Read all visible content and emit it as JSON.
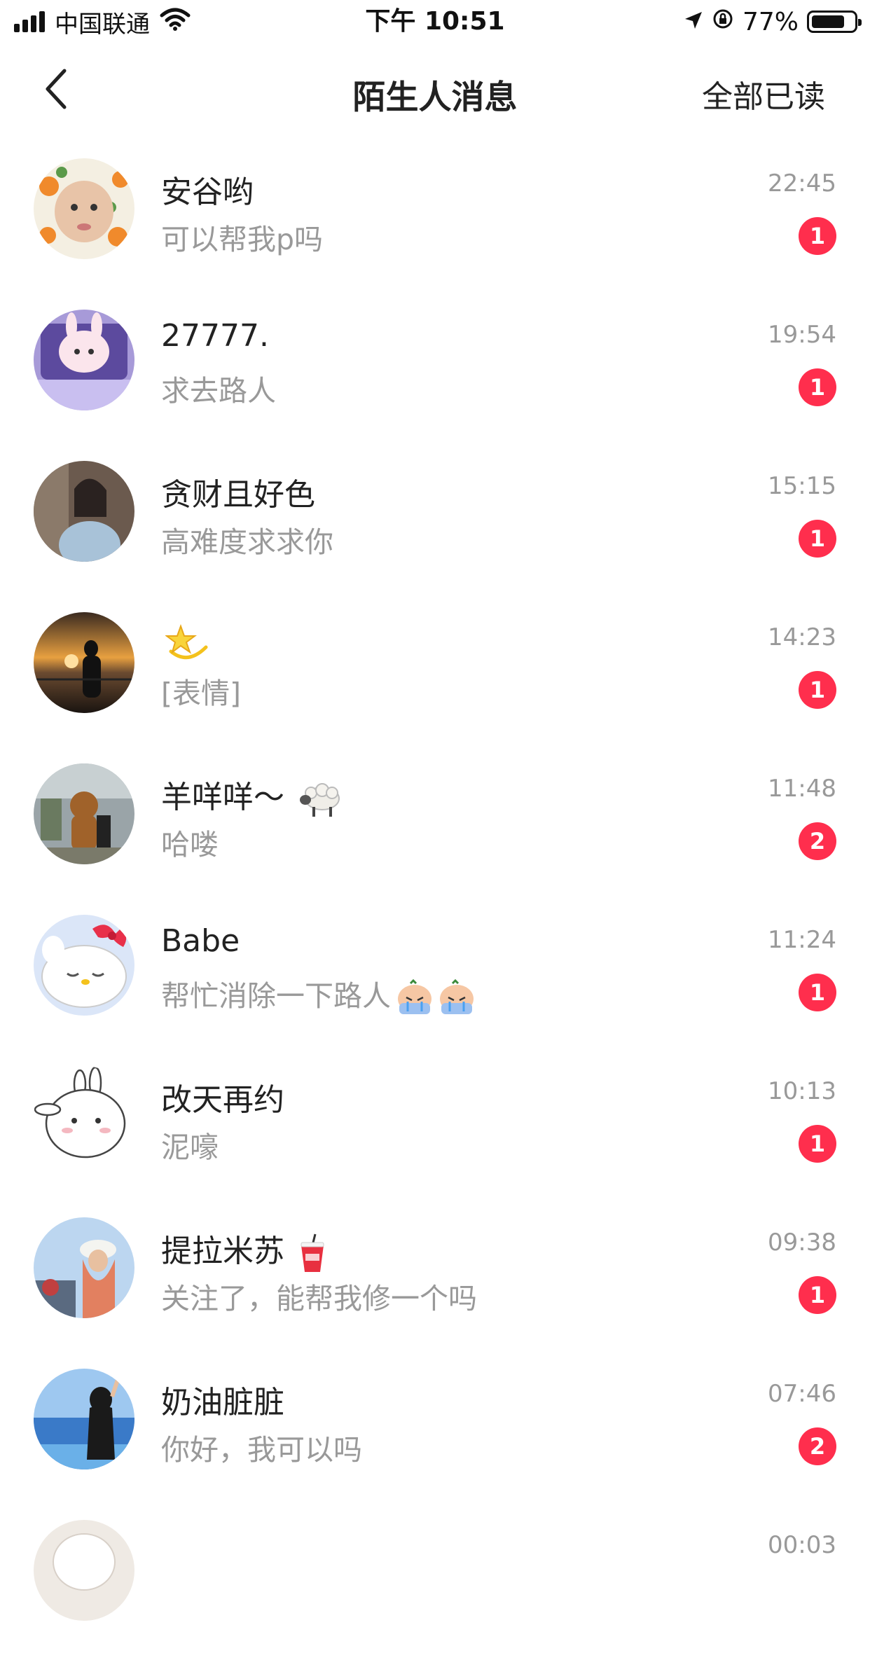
{
  "status_bar": {
    "carrier": "中国联通",
    "time": "下午 10:51",
    "battery_percent": "77%",
    "icons": [
      "signal-icon",
      "wifi-icon",
      "location-icon",
      "orientation-lock-icon",
      "battery-icon"
    ]
  },
  "nav": {
    "back_icon": "chevron-left-icon",
    "title": "陌生人消息",
    "mark_all_read": "全部已读"
  },
  "messages": [
    {
      "name": "安谷哟",
      "preview": "可以帮我p吗",
      "time": "22:45",
      "unread": "1"
    },
    {
      "name": "27777.",
      "preview": "求去路人",
      "time": "19:54",
      "unread": "1"
    },
    {
      "name": "贪财且好色",
      "preview": "高难度求求你",
      "time": "15:15",
      "unread": "1"
    },
    {
      "name": "",
      "name_emoji": "dizzy-star-icon",
      "preview": "[表情]",
      "time": "14:23",
      "unread": "1"
    },
    {
      "name": "羊咩咩～",
      "name_emoji": "sheep-icon",
      "preview": "哈喽",
      "time": "11:48",
      "unread": "2"
    },
    {
      "name": "Babe",
      "preview": "帮忙消除一下路人",
      "preview_emoji": "crying-face-icon",
      "time": "11:24",
      "unread": "1"
    },
    {
      "name": "改天再约",
      "preview": "泥嚎",
      "time": "10:13",
      "unread": "1"
    },
    {
      "name": "提拉米苏",
      "name_emoji": "drink-cup-icon",
      "preview": "关注了，能帮我修一个吗",
      "time": "09:38",
      "unread": "1"
    },
    {
      "name": "奶油脏脏",
      "preview": "你好，我可以吗",
      "time": "07:46",
      "unread": "2"
    },
    {
      "name": "",
      "preview": "",
      "time": "00:03",
      "unread": ""
    }
  ],
  "colors": {
    "badge": "#ff2e4d",
    "primary_text": "#222222",
    "secondary_text": "#999999"
  }
}
